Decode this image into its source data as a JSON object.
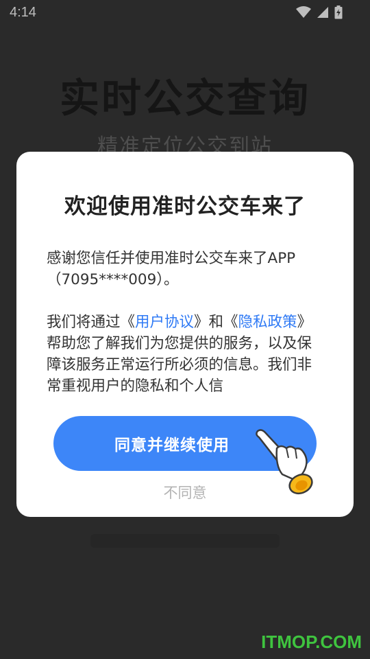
{
  "status_bar": {
    "time": "4:14",
    "icons": [
      "wifi-icon",
      "signal-icon",
      "battery-charging-icon"
    ]
  },
  "background": {
    "title": "实时公交查询",
    "subtitle": "精准定位公交到站"
  },
  "dialog": {
    "title": "欢迎使用准时公交车来了",
    "paragraph1_line1": "感谢您信任并使用准时公交车来了APP",
    "paragraph1_line2": "（7095****009）。",
    "paragraph2_intro": "我们将通过《",
    "user_agreement_link": "用户协议",
    "paragraph2_mid": "》和《",
    "privacy_policy_link": "隐私政策",
    "paragraph2_rest": "》帮助您了解我们为您提供的服务，以及保障该服务正常运行所必须的信息。我们非常重视用户的隐私和个人信",
    "agree_button": "同意并继续使用",
    "disagree_button": "不同意",
    "accent_color": "#3d86f8"
  },
  "watermark": "ITMOP.COM"
}
